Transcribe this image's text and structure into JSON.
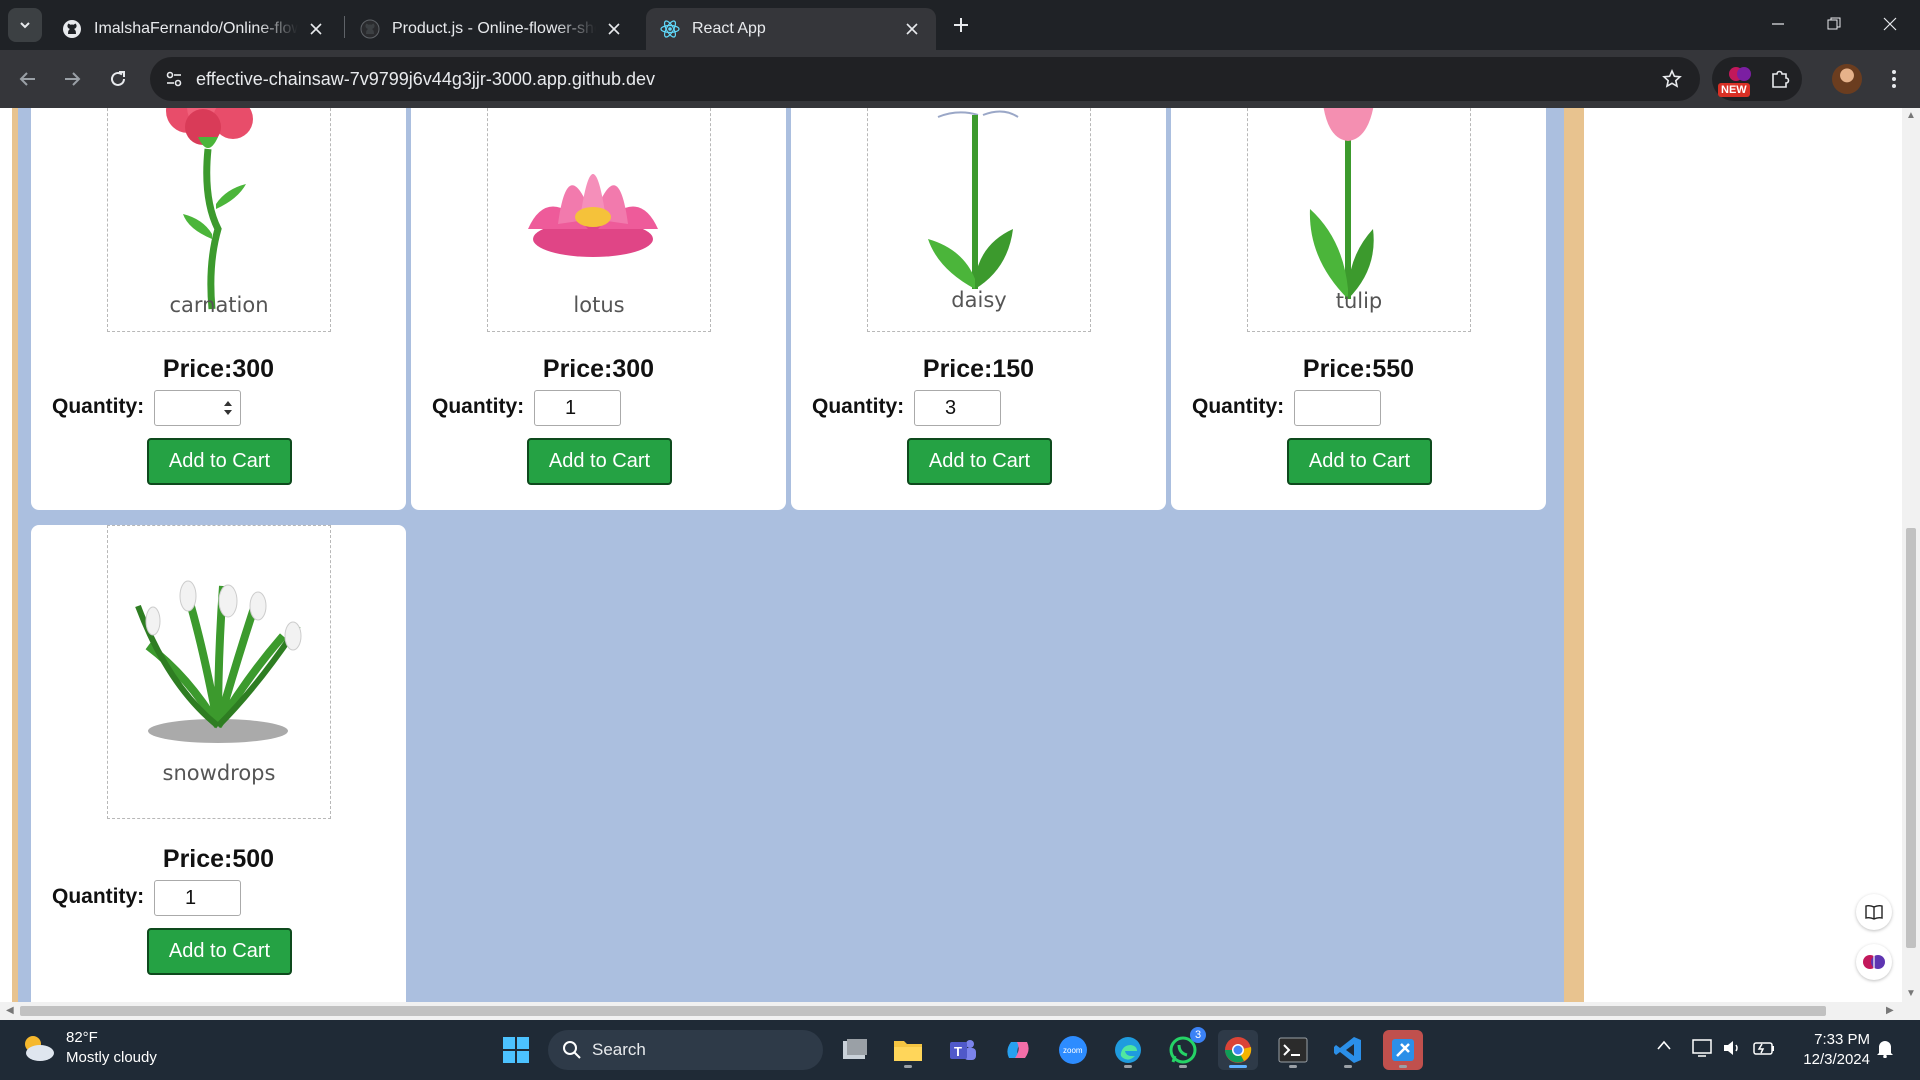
{
  "browser": {
    "tabs": [
      {
        "title": "ImalshaFernando/Online-flower",
        "favicon": "github-icon",
        "active": false
      },
      {
        "title": "Product.js - Online-flower-shop",
        "favicon": "github-icon",
        "active": false
      },
      {
        "title": "React App",
        "favicon": "react-icon",
        "active": true
      }
    ],
    "url": "effective-chainsaw-7v9799j6v44g3jjr-3000.app.github.dev",
    "extension_badge": "NEW"
  },
  "products": [
    {
      "name": "carnation",
      "price_text": "Price:300",
      "quantity_label": "Quantity:",
      "quantity_value": "",
      "button_label": "Add to Cart"
    },
    {
      "name": "lotus",
      "price_text": "Price:300",
      "quantity_label": "Quantity:",
      "quantity_value": "1",
      "button_label": "Add to Cart"
    },
    {
      "name": "daisy",
      "price_text": "Price:150",
      "quantity_label": "Quantity:",
      "quantity_value": "3",
      "button_label": "Add to Cart"
    },
    {
      "name": "tulip",
      "price_text": "Price:550",
      "quantity_label": "Quantity:",
      "quantity_value": "",
      "button_label": "Add to Cart"
    },
    {
      "name": "snowdrops",
      "price_text": "Price:500",
      "quantity_label": "Quantity:",
      "quantity_value": "1",
      "button_label": "Add to Cart"
    }
  ],
  "taskbar": {
    "weather_temp": "82°F",
    "weather_desc": "Mostly cloudy",
    "search_label": "Search",
    "whatsapp_badge": "3",
    "time": "7:33 PM",
    "date": "12/3/2024"
  },
  "colors": {
    "button_green": "#25a244",
    "page_background": "#abbfdf",
    "frame_border": "#e8c38f"
  }
}
